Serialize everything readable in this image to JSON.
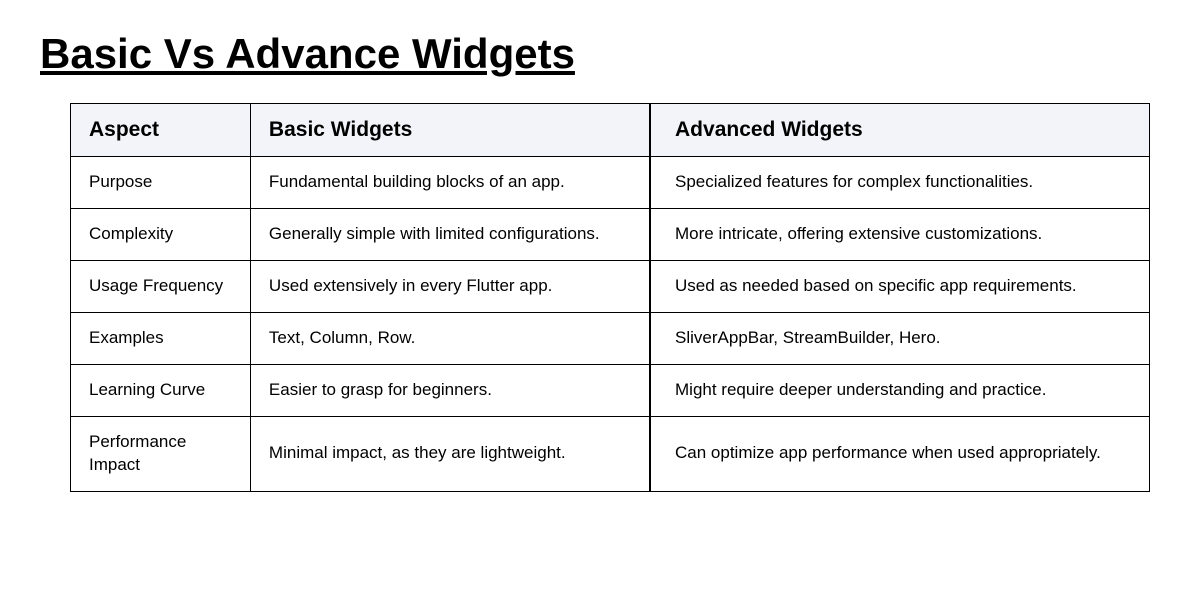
{
  "title": "Basic Vs Advance Widgets",
  "table": {
    "headers": {
      "aspect": "Aspect",
      "basic": "Basic Widgets",
      "advanced": "Advanced Widgets"
    },
    "rows": [
      {
        "aspect": "Purpose",
        "basic": "Fundamental building blocks of an app.",
        "advanced": "Specialized features for complex functionalities."
      },
      {
        "aspect": "Complexity",
        "basic": "Generally simple with limited configurations.",
        "advanced": "More intricate, offering extensive customizations."
      },
      {
        "aspect": "Usage Frequency",
        "basic": "Used extensively in every Flutter app.",
        "advanced": "Used as needed based on specific app requirements."
      },
      {
        "aspect": "Examples",
        "basic": "Text, Column, Row.",
        "advanced": "SliverAppBar, StreamBuilder, Hero."
      },
      {
        "aspect": "Learning Curve",
        "basic": "Easier to grasp for beginners.",
        "advanced": "Might require deeper understanding and practice."
      },
      {
        "aspect": "Performance Impact",
        "basic": "Minimal impact, as they are lightweight.",
        "advanced": "Can optimize app performance when used appropriately."
      }
    ]
  }
}
